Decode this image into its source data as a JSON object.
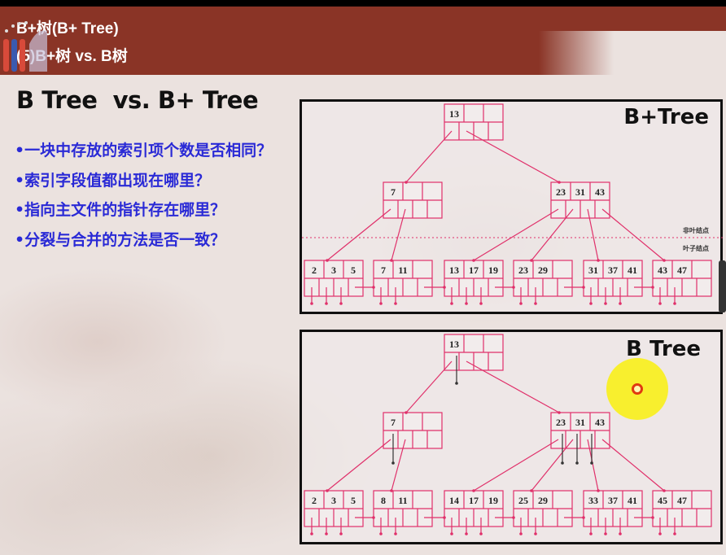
{
  "header": {
    "title": "B+树(B+ Tree)",
    "subtitle": "(5)B+树 vs. B树"
  },
  "slide": {
    "heading": "B Tree  vs. B+ Tree",
    "bullets": [
      "•一块中存放的索引项个数是否相同？",
      "•索引字段值都出现在哪里？",
      "•指向主文件的指针存在哪里？",
      "•分裂与合并的方法是否一致？"
    ]
  },
  "colors": {
    "header": "#8a3426",
    "bullet_text": "#2a2ad6",
    "tree_lines": "#e0306a",
    "cursor_highlight": "#f8f01e"
  },
  "bplus_tree": {
    "title": "B+Tree",
    "nonleaf_label": "非叶结点",
    "leaf_label": "叶子结点",
    "root": [
      "13"
    ],
    "internal": [
      [
        "7"
      ],
      [
        "23",
        "31",
        "43"
      ]
    ],
    "leaves": [
      [
        "2",
        "3",
        "5"
      ],
      [
        "7",
        "11"
      ],
      [
        "13",
        "17",
        "19"
      ],
      [
        "23",
        "29"
      ],
      [
        "31",
        "37",
        "41"
      ],
      [
        "43",
        "47"
      ]
    ]
  },
  "b_tree": {
    "title": "B Tree",
    "root": [
      "13"
    ],
    "internal": [
      [
        "7"
      ],
      [
        "23",
        "31",
        "43"
      ]
    ],
    "leaves": [
      [
        "2",
        "3",
        "5"
      ],
      [
        "8",
        "11"
      ],
      [
        "14",
        "17",
        "19"
      ],
      [
        "25",
        "29"
      ],
      [
        "33",
        "37",
        "41"
      ],
      [
        "45",
        "47"
      ]
    ]
  }
}
